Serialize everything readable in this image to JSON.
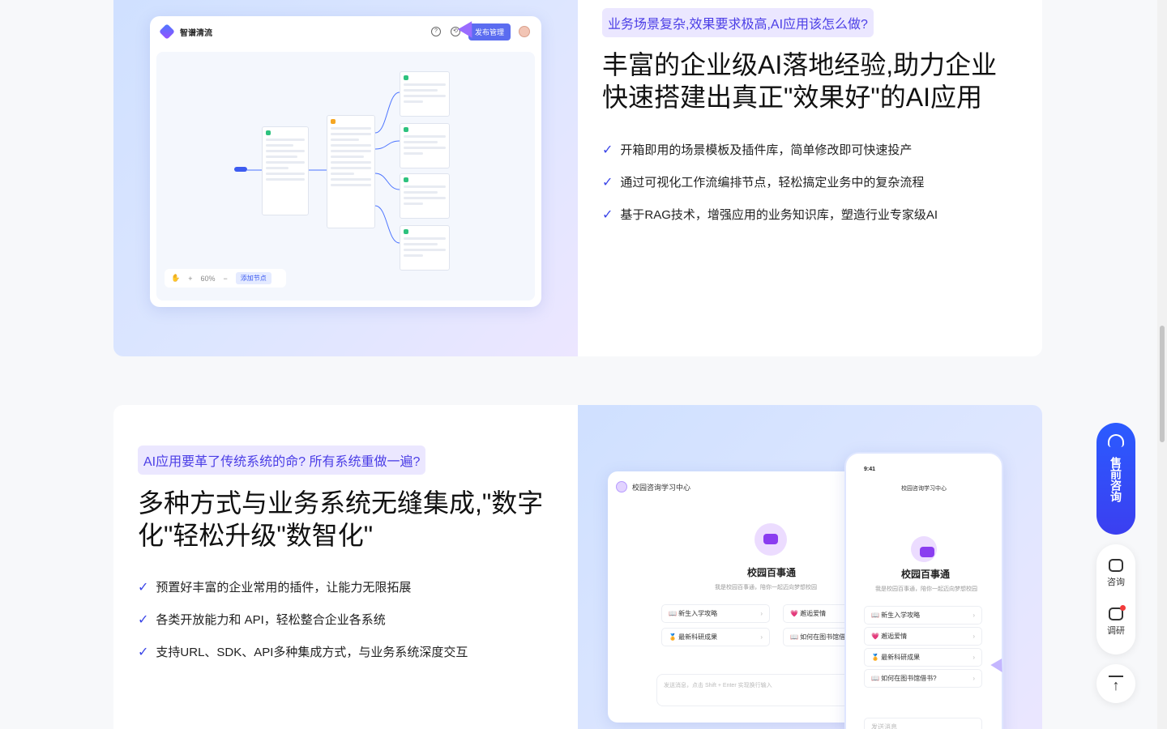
{
  "section1": {
    "tag": "业务场景复杂,效果要求极高,AI应用该怎么做?",
    "headline_line1": "丰富的企业级AI落地经验,助力企业",
    "headline_line2": "快速搭建出真正\"效果好\"的AI应用",
    "features": [
      "开箱即用的场景模板及插件库，简单修改即可快速投产",
      "通过可视化工作流编排节点，轻松搞定业务中的复杂流程",
      "基于RAG技术，增强应用的业务知识库，塑造行业专家级AI"
    ],
    "mockup": {
      "app_title": "智谱清流",
      "help_icon": "?",
      "history_icon": "⟲",
      "publish_label": "发布管理",
      "zoom": "60%",
      "zoom_in": "+",
      "zoom_out": "−",
      "add_node_label": "添加节点"
    }
  },
  "section2": {
    "tag": "AI应用要革了传统系统的命? 所有系统重做一遍?",
    "headline_line1": "多种方式与业务系统无缝集成,\"数字",
    "headline_line2": "化\"轻松升级\"数智化\"",
    "features": [
      "预置好丰富的企业常用的插件，让能力无限拓展",
      "各类开放能力和 API，轻松整合企业各系统",
      "支持URL、SDK、API多种集成方式，与业务系统深度交互"
    ],
    "mockup": {
      "desktop_header": "校园咨询学习中心",
      "app_name": "校园百事通",
      "app_desc": "我是校园百事通，陪你一起迈向梦想校园",
      "desk_chips": [
        "📖 新生入学攻略",
        "💗 邂逅爱情",
        "🏅 最新科研成果",
        "📖 如何在图书馆借书"
      ],
      "desk_input_placeholder": "发送消息，点击 Shift + Enter 实现换行输入",
      "phone_time": "9:41",
      "phone_header": "校园咨询学习中心",
      "phone_chips": [
        "📖 新生入学攻略",
        "💗 邂逅爱情",
        "🏅 最新科研成果",
        "📖 如何在图书馆借书?"
      ],
      "phone_input_placeholder": "发送消息"
    }
  },
  "side": {
    "presale_label": "售前咨询",
    "consult_label": "咨询",
    "survey_label": "调研",
    "back_top_icon": "↑"
  },
  "colors": {
    "accent": "#3b46e8",
    "tag_bg": "#ebe7ff",
    "presale_bg": "#2b5bff"
  }
}
